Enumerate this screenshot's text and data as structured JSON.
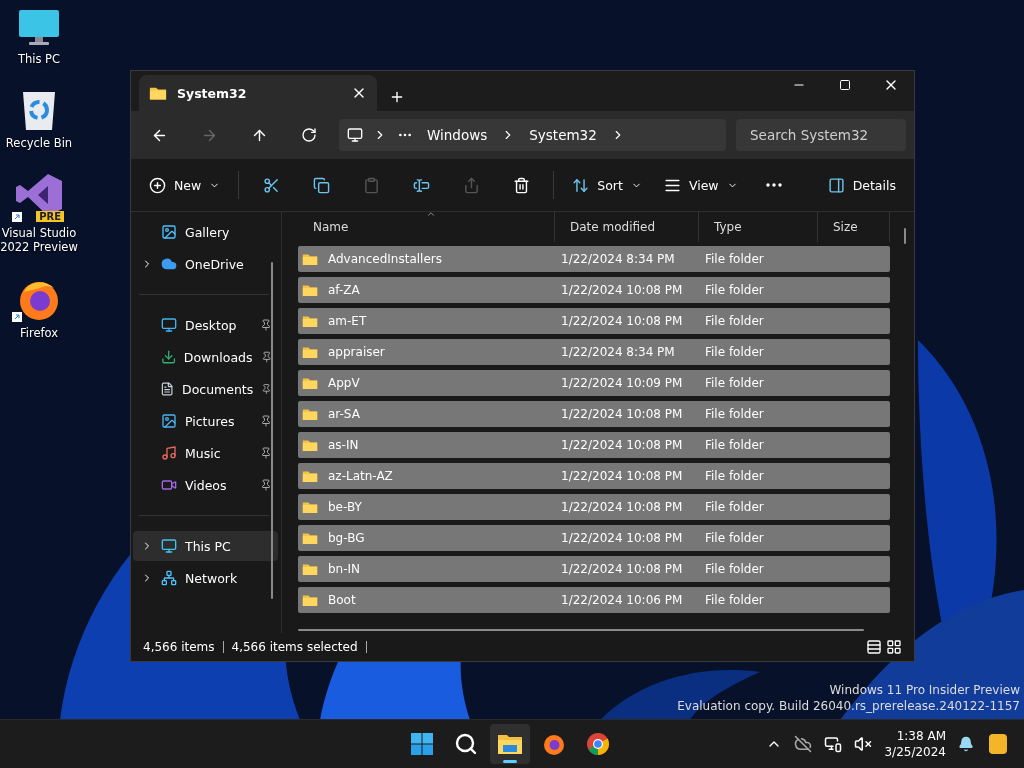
{
  "desktop_icons": [
    {
      "kind": "pc",
      "label": "This PC",
      "shortcut": false
    },
    {
      "kind": "bin",
      "label": "Recycle Bin",
      "shortcut": false
    },
    {
      "kind": "vs",
      "label": "Visual Studio 2022 Preview",
      "shortcut": true,
      "badge": "PRE"
    },
    {
      "kind": "firefox",
      "label": "Firefox",
      "shortcut": true
    }
  ],
  "window": {
    "tab": {
      "title": "System32"
    },
    "breadcrumb": [
      "Windows",
      "System32"
    ],
    "search": {
      "placeholder": "Search System32"
    },
    "commands": {
      "new": "New",
      "sort": "Sort",
      "view": "View",
      "details": "Details"
    },
    "sidebar": {
      "sections": [
        {
          "items": [
            {
              "kind": "gallery",
              "label": "Gallery",
              "pinned": false,
              "selected": false
            },
            {
              "kind": "onedrive",
              "label": "OneDrive",
              "expanded": false,
              "pinned": false,
              "selected": false
            }
          ]
        },
        {
          "items": [
            {
              "kind": "desktop",
              "label": "Desktop",
              "pinned": true,
              "selected": false
            },
            {
              "kind": "downloads",
              "label": "Downloads",
              "pinned": true,
              "selected": false
            },
            {
              "kind": "documents",
              "label": "Documents",
              "pinned": true,
              "selected": false
            },
            {
              "kind": "pictures",
              "label": "Pictures",
              "pinned": true,
              "selected": false
            },
            {
              "kind": "music",
              "label": "Music",
              "pinned": true,
              "selected": false
            },
            {
              "kind": "videos",
              "label": "Videos",
              "pinned": true,
              "selected": false
            }
          ]
        },
        {
          "items": [
            {
              "kind": "pc",
              "label": "This PC",
              "expanded": false,
              "pinned": false,
              "selected": true
            },
            {
              "kind": "network",
              "label": "Network",
              "expanded": false,
              "pinned": false,
              "selected": false
            }
          ]
        }
      ]
    },
    "table": {
      "columns": [
        {
          "label": "Name",
          "sorted": true
        },
        {
          "label": "Date modified",
          "sorted": false
        },
        {
          "label": "Type",
          "sorted": false
        },
        {
          "label": "Size",
          "sorted": false
        }
      ],
      "rows": [
        {
          "name": "AdvancedInstallers",
          "date": "1/22/2024 8:34 PM",
          "type": "File folder",
          "selected": true
        },
        {
          "name": "af-ZA",
          "date": "1/22/2024 10:08 PM",
          "type": "File folder",
          "selected": true
        },
        {
          "name": "am-ET",
          "date": "1/22/2024 10:08 PM",
          "type": "File folder",
          "selected": true
        },
        {
          "name": "appraiser",
          "date": "1/22/2024 8:34 PM",
          "type": "File folder",
          "selected": true
        },
        {
          "name": "AppV",
          "date": "1/22/2024 10:09 PM",
          "type": "File folder",
          "selected": true
        },
        {
          "name": "ar-SA",
          "date": "1/22/2024 10:08 PM",
          "type": "File folder",
          "selected": true
        },
        {
          "name": "as-IN",
          "date": "1/22/2024 10:08 PM",
          "type": "File folder",
          "selected": true
        },
        {
          "name": "az-Latn-AZ",
          "date": "1/22/2024 10:08 PM",
          "type": "File folder",
          "selected": true
        },
        {
          "name": "be-BY",
          "date": "1/22/2024 10:08 PM",
          "type": "File folder",
          "selected": true
        },
        {
          "name": "bg-BG",
          "date": "1/22/2024 10:08 PM",
          "type": "File folder",
          "selected": true
        },
        {
          "name": "bn-IN",
          "date": "1/22/2024 10:08 PM",
          "type": "File folder",
          "selected": true
        },
        {
          "name": "Boot",
          "date": "1/22/2024 10:06 PM",
          "type": "File folder",
          "selected": true
        }
      ]
    },
    "status_bar": {
      "count": "4,566 items",
      "selection": "4,566 items selected"
    }
  },
  "watermark_os": [
    "Windows 11 Pro Insider Preview",
    "Evaluation copy. Build 26040.rs_prerelease.240122-1157"
  ],
  "taskbar": {
    "apps": [
      {
        "kind": "start",
        "selected": false
      },
      {
        "kind": "search",
        "selected": false
      },
      {
        "kind": "explorer",
        "selected": true
      },
      {
        "kind": "firefox",
        "selected": false
      },
      {
        "kind": "chrome",
        "selected": false
      }
    ],
    "clock": {
      "time": "1:38 AM",
      "date": "3/25/2024"
    }
  }
}
